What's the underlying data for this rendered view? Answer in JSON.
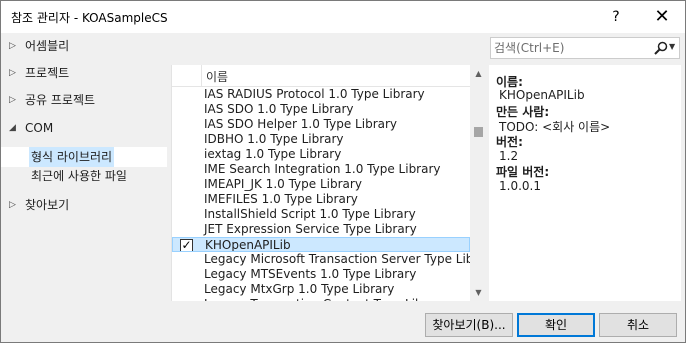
{
  "window": {
    "title": "참조 관리자 - KOASampleCS",
    "help_glyph": "?",
    "close_glyph": "✕"
  },
  "left_nav": {
    "items": [
      {
        "label": "어셈블리",
        "expanded": false
      },
      {
        "label": "프로젝트",
        "expanded": false
      },
      {
        "label": "공유 프로젝트",
        "expanded": false
      },
      {
        "label": "COM",
        "expanded": true
      },
      {
        "label": "찾아보기",
        "expanded": false
      }
    ],
    "com_children": [
      {
        "label": "형식 라이브러리",
        "selected": true
      },
      {
        "label": "최근에 사용한 파일",
        "selected": false
      }
    ]
  },
  "search": {
    "placeholder": "검색(Ctrl+E)"
  },
  "list": {
    "header_name": "이름",
    "rows": [
      {
        "name": "IAS RADIUS Protocol 1.0 Type Library",
        "checked": false,
        "selected": false
      },
      {
        "name": "IAS SDO 1.0 Type Library",
        "checked": false,
        "selected": false
      },
      {
        "name": "IAS SDO Helper 1.0 Type Library",
        "checked": false,
        "selected": false
      },
      {
        "name": "IDBHO 1.0 Type Library",
        "checked": false,
        "selected": false
      },
      {
        "name": "iextag 1.0 Type Library",
        "checked": false,
        "selected": false
      },
      {
        "name": "IME Search Integration 1.0 Type Library",
        "checked": false,
        "selected": false
      },
      {
        "name": "IMEAPI_JK 1.0 Type Library",
        "checked": false,
        "selected": false
      },
      {
        "name": "IMEFILES 1.0 Type Library",
        "checked": false,
        "selected": false
      },
      {
        "name": "InstallShield Script 1.0 Type Library",
        "checked": false,
        "selected": false
      },
      {
        "name": "JET Expression Service Type Library",
        "checked": false,
        "selected": false
      },
      {
        "name": "KHOpenAPILib",
        "checked": true,
        "selected": true
      },
      {
        "name": "Legacy Microsoft Transaction Server Type Libr...",
        "checked": false,
        "selected": false
      },
      {
        "name": "Legacy MTSEvents 1.0 Type Library",
        "checked": false,
        "selected": false
      },
      {
        "name": "Legacy MtxGrp 1.0 Type Library",
        "checked": false,
        "selected": false
      },
      {
        "name": "Legacy Transaction Context Type Library",
        "checked": false,
        "selected": false
      }
    ],
    "check_glyph": "✓"
  },
  "details": {
    "name_label": "이름:",
    "name_value": "KHOpenAPILib",
    "author_label": "만든 사람:",
    "author_value": "TODO: <회사 이름>",
    "version_label": "버전:",
    "version_value": "1.2",
    "file_version_label": "파일 버전:",
    "file_version_value": "1.0.0.1"
  },
  "footer": {
    "browse_label": "찾아보기(B)...",
    "ok_label": "확인",
    "cancel_label": "취소"
  }
}
